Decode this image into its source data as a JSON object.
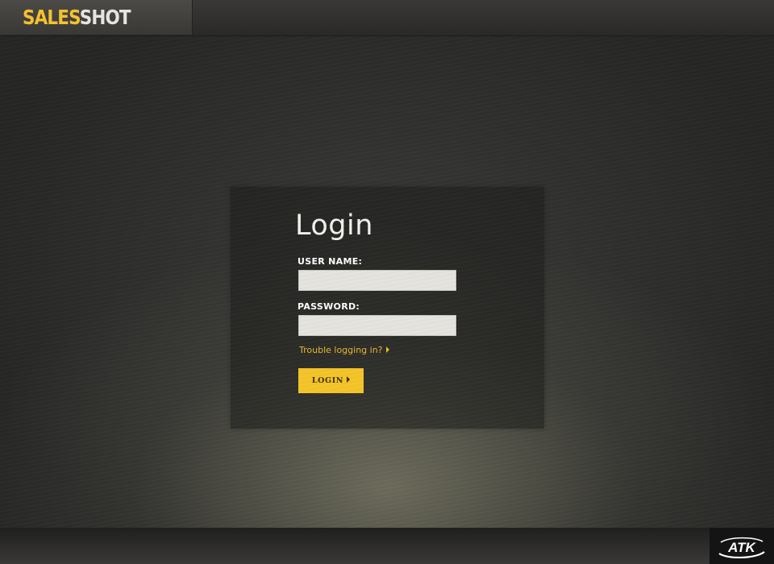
{
  "header": {
    "brand_part1": "SALES",
    "brand_part2": "SHOT"
  },
  "login": {
    "title": "Login",
    "username_label": "USER NAME:",
    "username_value": "",
    "password_label": "PASSWORD:",
    "password_value": "",
    "trouble_link": "Trouble logging in?",
    "login_button": "LOGIN"
  },
  "footer": {
    "logo_text": "ATK"
  },
  "colors": {
    "accent": "#f5c529",
    "link": "#e9b92c",
    "field_bg": "#e6e4df"
  },
  "icons": {
    "link_arrow": "triangle-right-icon",
    "button_arrow": "triangle-right-icon"
  }
}
